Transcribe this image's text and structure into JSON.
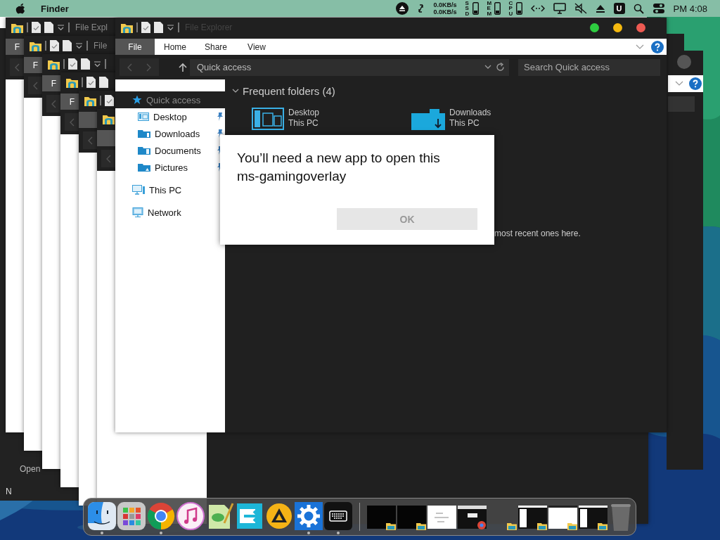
{
  "menu_bar": {
    "app_name": "Finder",
    "net_up": "0.0KB/s",
    "net_down": "0.0KB/s",
    "meters": [
      {
        "label": "SSD"
      },
      {
        "label": "MEM"
      },
      {
        "label": "CPU"
      }
    ],
    "badge": "U",
    "clock": "PM 4:08"
  },
  "back_window": {
    "texts": [
      "Open",
      "N"
    ]
  },
  "stacked_windows": [
    {
      "kind": "explorer",
      "title": "File Expl",
      "tab": "F"
    },
    {
      "kind": "explorer",
      "title": "File",
      "tab": "F"
    },
    {
      "kind": "explorer",
      "tab": "F"
    },
    {
      "kind": "explorer",
      "tab": "F"
    },
    {
      "kind": "explorer"
    },
    {
      "kind": "explorer"
    }
  ],
  "front_window": {
    "title": "File Explorer",
    "ribbon_tabs": [
      {
        "label": "File",
        "selected": true
      },
      {
        "label": "Home",
        "selected": false
      },
      {
        "label": "Share",
        "selected": false
      },
      {
        "label": "View",
        "selected": false
      }
    ],
    "address": "Quick access",
    "search_placeholder": "Search Quick access",
    "sidebar": [
      {
        "label": "Quick access",
        "kind": "star",
        "selected": true,
        "children": [
          {
            "label": "Desktop",
            "kind": "desktop",
            "pinned": true
          },
          {
            "label": "Downloads",
            "kind": "downloads",
            "pinned": true
          },
          {
            "label": "Documents",
            "kind": "documents",
            "pinned": true
          },
          {
            "label": "Pictures",
            "kind": "pictures",
            "pinned": true
          }
        ]
      },
      {
        "label": "This PC",
        "kind": "pc",
        "selected": false
      },
      {
        "label": "Network",
        "kind": "network",
        "selected": false
      }
    ],
    "section": "Frequent folders (4)",
    "folders": [
      {
        "name": "Desktop",
        "location": "This PC",
        "kind": "desktop"
      },
      {
        "name": "Downloads",
        "location": "This PC",
        "kind": "downloads"
      }
    ],
    "recent_note": "most recent ones here."
  },
  "dialog": {
    "message": "You’ll need a new app to open this ms-gamingoverlay",
    "button": "OK"
  },
  "dock": {
    "apps": [
      {
        "kind": "finder",
        "running": true
      },
      {
        "kind": "launchpad",
        "running": false
      },
      {
        "kind": "chrome",
        "running": true
      },
      {
        "kind": "music",
        "running": false
      },
      {
        "kind": "notepad",
        "running": false
      },
      {
        "kind": "arrow",
        "running": false
      },
      {
        "kind": "triangle",
        "running": false
      },
      {
        "kind": "gear",
        "running": true
      },
      {
        "kind": "keyboard",
        "running": true
      }
    ],
    "windows": [
      {
        "kind": "dark"
      },
      {
        "kind": "dark"
      },
      {
        "kind": "document"
      },
      {
        "kind": "browser"
      },
      {
        "kind": "folder"
      },
      {
        "kind": "explorer"
      },
      {
        "kind": "white"
      },
      {
        "kind": "explorer"
      }
    ]
  }
}
